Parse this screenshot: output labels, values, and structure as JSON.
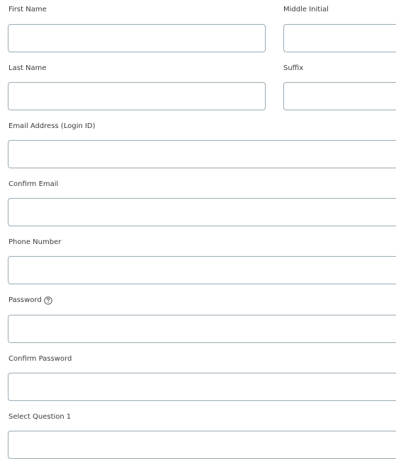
{
  "form": {
    "first_name": {
      "label": "First Name",
      "value": "",
      "placeholder": ""
    },
    "middle_initial": {
      "label": "Middle Initial",
      "value": "",
      "placeholder": ""
    },
    "last_name": {
      "label": "Last Name",
      "value": "",
      "placeholder": ""
    },
    "suffix": {
      "label": "Suffix",
      "value": "",
      "placeholder": ""
    },
    "email": {
      "label": "Email Address (Login ID)",
      "value": "",
      "placeholder": ""
    },
    "confirm_email": {
      "label": "Confirm Email",
      "value": "",
      "placeholder": ""
    },
    "phone": {
      "label": "Phone Number",
      "value": "",
      "placeholder": ""
    },
    "password": {
      "label": "Password",
      "value": "",
      "placeholder": "",
      "help_icon": "question-circle-icon"
    },
    "confirm_password": {
      "label": "Confirm Password",
      "value": "",
      "placeholder": ""
    },
    "select_question_1": {
      "label": "Select Question 1",
      "value": "",
      "placeholder": ""
    }
  }
}
